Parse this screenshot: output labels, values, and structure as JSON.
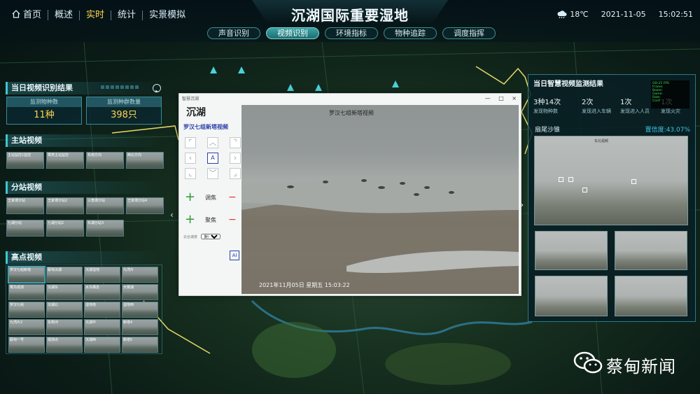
{
  "nav": {
    "items": [
      {
        "label": "首页",
        "active": false,
        "icon": "home-icon"
      },
      {
        "label": "概述",
        "active": false
      },
      {
        "label": "实时",
        "active": true
      },
      {
        "label": "统计",
        "active": false
      },
      {
        "label": "实景模拟",
        "active": false
      }
    ]
  },
  "header": {
    "title": "沉湖国际重要湿地",
    "temperature": "18℃",
    "date": "2021-11-05",
    "time": "15:02:51",
    "weather_icon": "cloud-rain-icon"
  },
  "subtabs": [
    {
      "label": "声音识别",
      "active": false
    },
    {
      "label": "视频识别",
      "active": true
    },
    {
      "label": "环境指标",
      "active": false
    },
    {
      "label": "物种追踪",
      "active": false
    },
    {
      "label": "调度指挥",
      "active": false
    }
  ],
  "left": {
    "daily_title": "当日视频识别结果",
    "stats": [
      {
        "label": "监测物种数",
        "value": "11种"
      },
      {
        "label": "监测种群数量",
        "value": "398只"
      }
    ],
    "main_station": {
      "title": "主站视频",
      "thumbs": [
        "主站监控1监控",
        "鹭类主站监控",
        "东南方向",
        "西北方向"
      ]
    },
    "sub_station": {
      "title": "分站视频",
      "thumbs": [
        "王家潭分站",
        "王家潭分站2",
        "三角潭分站",
        "王家潭分站4",
        "七湖分站",
        "七湖分站2",
        "东湖分站3"
      ]
    },
    "high_point": {
      "title": "高点视频",
      "thumbs": [
        "罗汉七组新塔",
        "蔡甸沉湖",
        "沉湖湿地",
        "九湾片",
        "鹭鸟观测",
        "沉湖东",
        "水鸟栖息",
        "大赛湖",
        "罗汉七组",
        "沉湖北",
        "湿地南",
        "湿地西",
        "九湾片2",
        "东荆河",
        "沉湖中",
        "新塔4",
        "蔡甸一号",
        "观测点",
        "沉湖西",
        "新塔5"
      ]
    }
  },
  "dialog": {
    "window_title": "智慧沉湖",
    "brand": "沉湖",
    "camera_name": "罗汉七组新塔视频",
    "zoom_label_1": "调焦",
    "zoom_label_2": "聚焦",
    "speed_label": "云台速度",
    "speed_value": "默认",
    "ai_label": "AI",
    "video_title": "罗汉七组新塔视频",
    "video_timestamp": "2021年11月05日 星期五 15:03:22",
    "controls": [
      "—",
      "□",
      "×"
    ]
  },
  "right": {
    "title": "当日智慧视频监测结果",
    "stats": [
      {
        "value": "3种14次",
        "label": "发现物种数"
      },
      {
        "value": "2次",
        "label": "发现进入车辆"
      },
      {
        "value": "1次",
        "label": "发现进入人员"
      },
      {
        "value": "1次",
        "label": "发现火灾"
      }
    ],
    "species": "扇尾沙锥",
    "confidence": "置信度:43.07%",
    "main_caption": "东北视频",
    "detection_text": [
      "OD:25 FPS",
      "Frame:",
      "Boxes:",
      "Game:",
      "Rate:",
      "Conf:"
    ]
  },
  "watermark": {
    "text": "蔡甸新闻",
    "icon": "wechat-icon"
  },
  "colors": {
    "accent": "#3fc7d0",
    "active_nav": "#ffd84d",
    "stat_value": "#ffd34d",
    "confidence": "#39c7e8"
  }
}
